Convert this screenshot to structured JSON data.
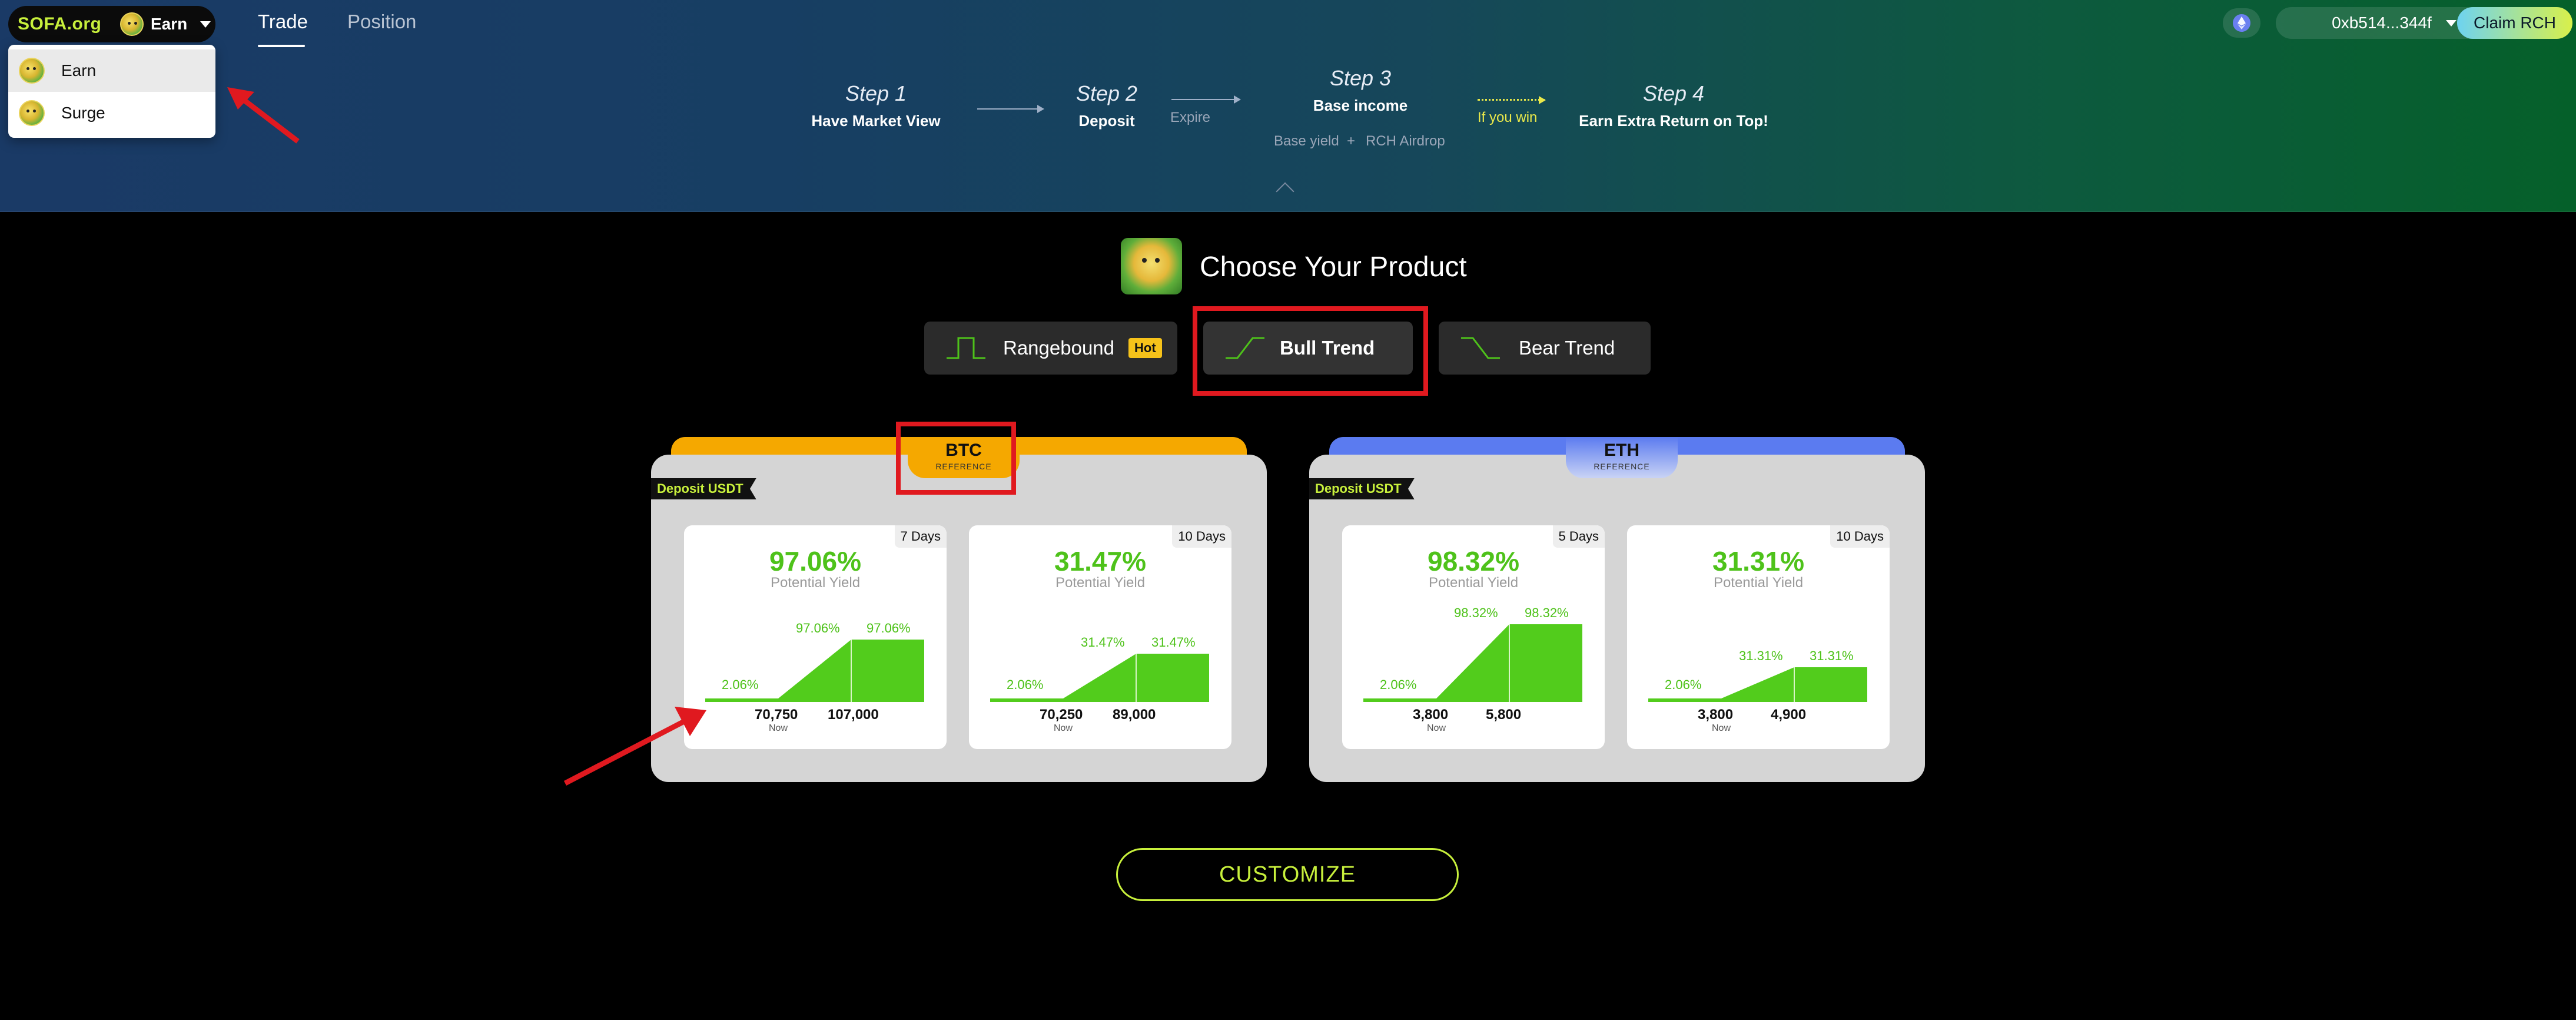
{
  "header": {
    "brand": "SOFA.org",
    "mode_label": "Earn",
    "nav_trade": "Trade",
    "nav_position": "Position",
    "wallet_address": "0xb514...344f",
    "claim_label": "Claim RCH",
    "network_icon": "ethereum-icon"
  },
  "mode_menu": {
    "items": [
      "Earn",
      "Surge"
    ],
    "selected": "Earn"
  },
  "steps": {
    "s1_title": "Step 1",
    "s1_desc": "Have Market View",
    "s2_title": "Step 2",
    "s2_desc": "Deposit",
    "expire": "Expire",
    "s3_title": "Step 3",
    "s3_desc": "Base income",
    "base_yield": "Base yield",
    "plus": "+",
    "rch_airdrop": "RCH Airdrop",
    "if_you_win": "If you win",
    "s4_title": "Step 4",
    "s4_desc": "Earn Extra Return on Top!"
  },
  "product": {
    "title": "Choose Your Product",
    "options": [
      "Rangebound",
      "Bull Trend",
      "Bear Trend"
    ],
    "hot_badge": "Hot",
    "selected": "Bull Trend"
  },
  "assets": [
    {
      "symbol": "BTC",
      "reference": "REFERENCE",
      "deposit": "Deposit USDT",
      "accent": "#f5a800",
      "cards": [
        {
          "days": "7 Days",
          "yield": "97.06%",
          "yield_label": "Potential Yield",
          "low": "2.06%",
          "high": "97.06%",
          "high2": "97.06%",
          "strike_low": "70,750",
          "strike_high": "107,000",
          "now": "Now",
          "high_level": 0.8
        },
        {
          "days": "10 Days",
          "yield": "31.47%",
          "yield_label": "Potential Yield",
          "low": "2.06%",
          "high": "31.47%",
          "high2": "31.47%",
          "strike_low": "70,250",
          "strike_high": "89,000",
          "now": "Now",
          "high_level": 0.62
        }
      ]
    },
    {
      "symbol": "ETH",
      "reference": "REFERENCE",
      "deposit": "Deposit USDT",
      "accent": "#5b7bf0",
      "cards": [
        {
          "days": "5 Days",
          "yield": "98.32%",
          "yield_label": "Potential Yield",
          "low": "2.06%",
          "high": "98.32%",
          "high2": "98.32%",
          "strike_low": "3,800",
          "strike_high": "5,800",
          "now": "Now",
          "high_level": 1.0
        },
        {
          "days": "10 Days",
          "yield": "31.31%",
          "yield_label": "Potential Yield",
          "low": "2.06%",
          "high": "31.31%",
          "high2": "31.31%",
          "strike_low": "3,800",
          "strike_high": "4,900",
          "now": "Now",
          "high_level": 0.45
        }
      ]
    }
  ],
  "customize_label": "CUSTOMIZE"
}
